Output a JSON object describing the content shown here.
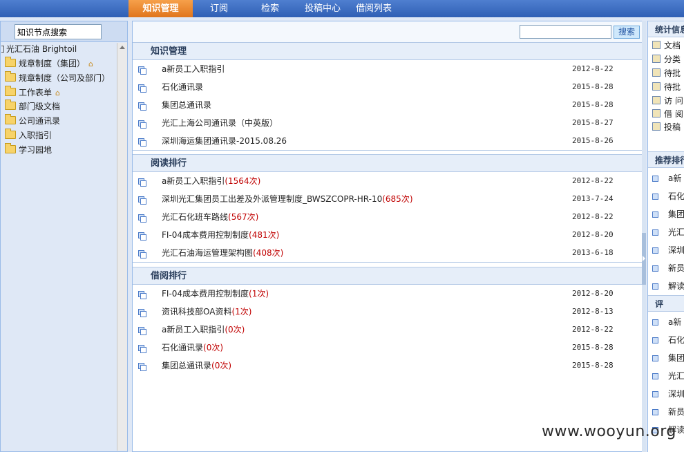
{
  "nav": {
    "tabs": [
      {
        "label": "知识管理",
        "active": true
      },
      {
        "label": "订阅",
        "active": false
      },
      {
        "label": "检索",
        "active": false
      },
      {
        "label": "投稿中心",
        "active": false
      },
      {
        "label": "借阅列表",
        "active": false
      }
    ]
  },
  "left": {
    "search_value": "知识节点搜索",
    "tree_root": "光汇石油 Brightoil",
    "items": [
      {
        "label": "规章制度（集团）",
        "icon": "folder-icon",
        "home": true
      },
      {
        "label": "规章制度（公司及部门）",
        "icon": "folder-icon",
        "home": false
      },
      {
        "label": "工作表单",
        "icon": "folder-icon",
        "home": true
      },
      {
        "label": "部门级文档",
        "icon": "folder-icon",
        "home": false
      },
      {
        "label": "公司通讯录",
        "icon": "folder-icon",
        "home": false
      },
      {
        "label": "入职指引",
        "icon": "folder-icon",
        "home": false
      },
      {
        "label": "学习园地",
        "icon": "folder-icon",
        "home": false
      }
    ]
  },
  "main": {
    "search_value": "",
    "search_button": "搜索",
    "sections": [
      {
        "title": "知识管理",
        "rows": [
          {
            "title": "a新员工入职指引",
            "count": "",
            "date": "2012-8-22"
          },
          {
            "title": "石化通讯录",
            "count": "",
            "date": "2015-8-28"
          },
          {
            "title": "集团总通讯录",
            "count": "",
            "date": "2015-8-28"
          },
          {
            "title": "光汇上海公司通讯录（中英版）",
            "count": "",
            "date": "2015-8-27"
          },
          {
            "title": "深圳海运集团通讯录-2015.08.26",
            "count": "",
            "date": "2015-8-26"
          }
        ]
      },
      {
        "title": "阅读排行",
        "rows": [
          {
            "title": "a新员工入职指引",
            "count": "(1564次)",
            "date": "2012-8-22"
          },
          {
            "title": "深圳光汇集团员工出差及外派管理制度_BWSZCOPR-HR-10",
            "count": "(685次)",
            "date": "2013-7-24"
          },
          {
            "title": "光汇石化班车路线",
            "count": "(567次)",
            "date": "2012-8-22"
          },
          {
            "title": "FI-04成本费用控制制度",
            "count": "(481次)",
            "date": "2012-8-20"
          },
          {
            "title": "光汇石油海运管理架构图",
            "count": "(408次)",
            "date": "2013-6-18"
          }
        ]
      },
      {
        "title": "借阅排行",
        "rows": [
          {
            "title": "FI-04成本费用控制制度",
            "count": "(1次)",
            "date": "2012-8-20"
          },
          {
            "title": "资讯科技部OA资料",
            "count": "(1次)",
            "date": "2012-8-13"
          },
          {
            "title": "a新员工入职指引",
            "count": "(0次)",
            "date": "2012-8-22"
          },
          {
            "title": "石化通讯录",
            "count": "(0次)",
            "date": "2015-8-28"
          },
          {
            "title": "集团总通讯录",
            "count": "(0次)",
            "date": "2015-8-28"
          }
        ]
      }
    ]
  },
  "right": {
    "stats_title": "统计信息",
    "stats": [
      {
        "label": "文档",
        "icon": "document-stat-icon"
      },
      {
        "label": "分类",
        "icon": "category-stat-icon"
      },
      {
        "label": "待批",
        "icon": "pending-approval-icon"
      },
      {
        "label": "待批",
        "icon": "pending-borrow-icon"
      },
      {
        "label": "访 问",
        "icon": "visitors-icon"
      },
      {
        "label": "借 阅",
        "icon": "borrow-icon"
      },
      {
        "label": "投稿",
        "icon": "contributor-icon"
      }
    ],
    "recommend_title": "推荐排行",
    "recommend": [
      "a新",
      "石化",
      "集团",
      "光汇",
      "深圳",
      "新员",
      "解读"
    ],
    "comment_title": "评",
    "comments": [
      "a新",
      "石化",
      "集团",
      "光汇",
      "深圳",
      "新员",
      "解读"
    ]
  },
  "watermark": "www.wooyun.org"
}
